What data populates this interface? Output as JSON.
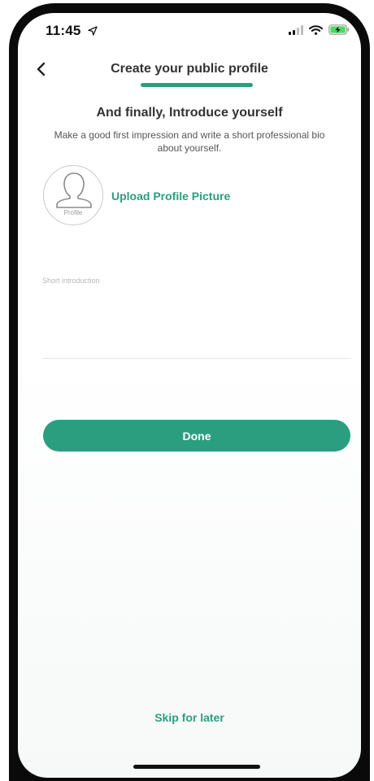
{
  "status_bar": {
    "time": "11:45",
    "location_icon": "location-arrow-icon",
    "signal_icon": "cellular-signal-icon",
    "wifi_icon": "wifi-icon",
    "battery_icon": "battery-charging-icon"
  },
  "nav": {
    "back_icon": "chevron-left-icon",
    "title": "Create your public profile"
  },
  "content": {
    "heading": "And finally, Introduce yourself",
    "subtext": "Make a good first impression and write a short professional bio about yourself.",
    "avatar_label": "Profile",
    "upload_label": "Upload Profile Picture",
    "intro_placeholder": "Short introduction",
    "intro_value": ""
  },
  "actions": {
    "done_label": "Done",
    "skip_label": "Skip for later"
  },
  "colors": {
    "accent": "#2b9e80",
    "bezel": "#0a0a0a",
    "title_text": "#333333"
  }
}
